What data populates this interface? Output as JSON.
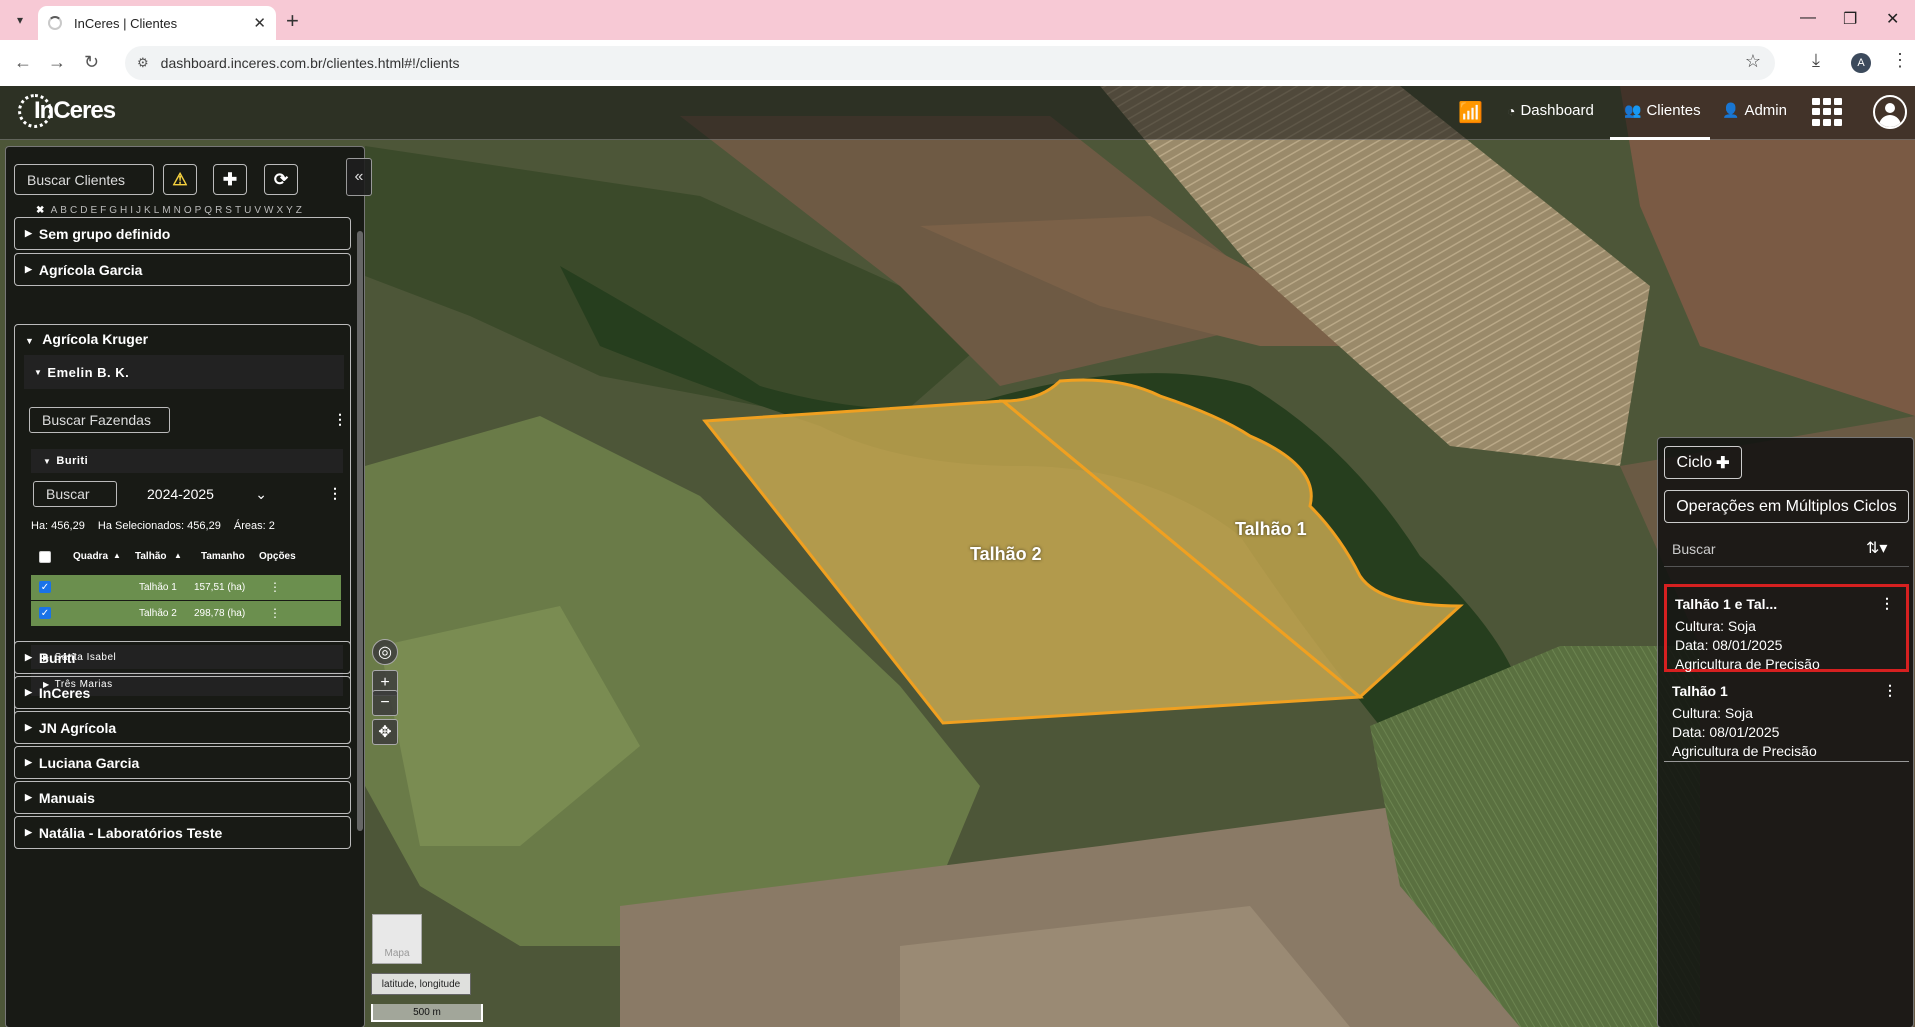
{
  "browser": {
    "tab_title": "InCeres | Clientes",
    "url": "dashboard.inceres.com.br/clientes.html#!/clients",
    "profile_initial": "A"
  },
  "app": {
    "logo_text": "InCeres",
    "nav": {
      "dashboard": "Dashboard",
      "clientes": "Clientes",
      "admin": "Admin"
    },
    "wifi_color": "#6fe02a"
  },
  "left_panel": {
    "search_placeholder": "Buscar Clientes",
    "alphabet": [
      "A",
      "B",
      "C",
      "D",
      "E",
      "F",
      "G",
      "H",
      "I",
      "J",
      "K",
      "L",
      "M",
      "N",
      "O",
      "P",
      "Q",
      "R",
      "S",
      "T",
      "U",
      "V",
      "W",
      "X",
      "Y",
      "Z"
    ],
    "groups_top": [
      "Sem grupo definido",
      "Agrícola Garcia"
    ],
    "expanded_group": {
      "name": "Agrícola Kruger",
      "client": "Emelin B. K.",
      "farm_search_placeholder": "Buscar Fazendas",
      "farm": {
        "name": "Buriti",
        "search_placeholder": "Buscar",
        "cycle": "2024-2025",
        "ha": "Ha: 456,29",
        "ha_selected": "Ha Selecionados: 456,29",
        "areas": "Áreas: 2",
        "columns": [
          "Quadra",
          "Talhão",
          "Tamanho",
          "Opções"
        ],
        "rows": [
          {
            "talhao": "Talhão 1",
            "tamanho": "157,51 (ha)"
          },
          {
            "talhao": "Talhão 2",
            "tamanho": "298,78 (ha)"
          }
        ]
      },
      "other_farms": [
        "Santa Isabel",
        "Três Marias"
      ]
    },
    "groups_bottom": [
      "Buriti",
      "InCeres",
      "JN Agrícola",
      "Luciana Garcia",
      "Manuais",
      "Natália - Laboratórios Teste"
    ]
  },
  "right_panel": {
    "ciclo_label": "Ciclo",
    "multi_cycle_label": "Operações em Múltiplos Ciclos",
    "search_placeholder": "Buscar",
    "operations": [
      {
        "title": "Talhão 1 e Tal...",
        "cultura": "Cultura: Soja",
        "data": "Data: 08/01/2025",
        "tipo": "Agricultura de Precisão"
      },
      {
        "title": "Talhão 1",
        "cultura": "Cultura: Soja",
        "data": "Data: 08/01/2025",
        "tipo": "Agricultura de Precisão"
      }
    ]
  },
  "map": {
    "labels": {
      "talhao1": "Talhão 1",
      "talhao2": "Talhão 2"
    },
    "basemap_label": "Mapa",
    "coord_label": "latitude, longitude",
    "scale_label": "500 m",
    "field_fill": "#c4a650",
    "field_stroke": "#f0a020"
  }
}
